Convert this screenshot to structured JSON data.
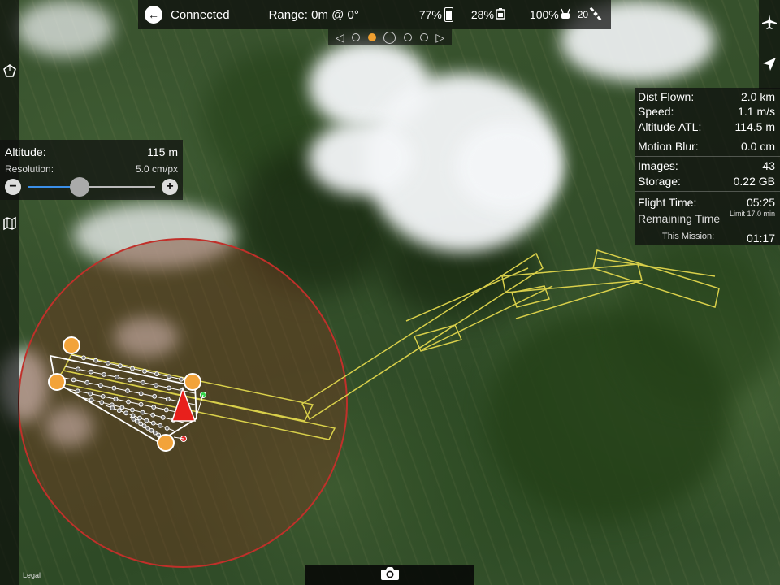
{
  "topbar": {
    "connection": "Connected",
    "range": "Range: 0m @ 0°",
    "phone_battery": "77%",
    "drone_battery": "28%",
    "signal": "100%",
    "satellites": "20"
  },
  "altitude_panel": {
    "altitude_label": "Altitude:",
    "altitude_value": "115 m",
    "resolution_label": "Resolution:",
    "resolution_value": "5.0 cm/px",
    "slider_level": 0.41
  },
  "telemetry": {
    "dist_flown_label": "Dist Flown:",
    "dist_flown_value": "2.0 km",
    "speed_label": "Speed:",
    "speed_value": "1.1 m/s",
    "altitude_atl_label": "Altitude ATL:",
    "altitude_atl_value": "114.5 m",
    "motion_blur_label": "Motion Blur:",
    "motion_blur_value": "0.0 cm",
    "images_label": "Images:",
    "images_value": "43",
    "storage_label": "Storage:",
    "storage_value": "0.22 GB",
    "flight_time_label": "Flight Time:",
    "flight_time_value": "05:25",
    "remaining_time_label": "Remaining Time",
    "limit_label": "Limit 17.0 min",
    "this_mission_label": "This Mission:",
    "this_mission_value": "01:17"
  },
  "map": {
    "legal": "Legal"
  },
  "colors": {
    "range_circle": "#c0302a",
    "flight_path": "#d8cf4a",
    "waypoint": "#f2a33a",
    "drone_marker": "#e8201c",
    "slider_fill": "#3b8fe8"
  },
  "icons": {
    "back": "back-arrow-icon",
    "phone_battery": "phone-battery-icon",
    "drone_battery": "drone-battery-icon",
    "signal": "controller-signal-icon",
    "satellites": "satellite-icon",
    "draw_area": "polygon-icon",
    "map_layers": "map-icon",
    "aircraft": "airplane-icon",
    "navigate": "navigation-arrow-icon",
    "camera": "camera-icon"
  }
}
